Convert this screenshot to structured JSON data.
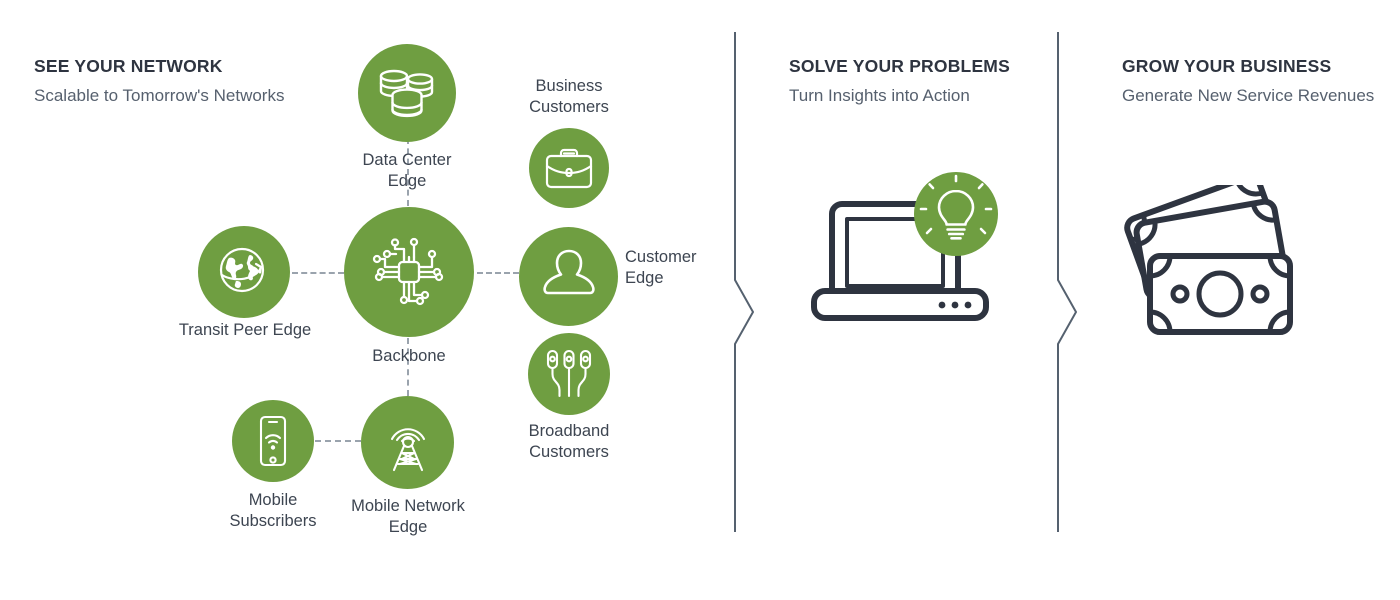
{
  "theme": {
    "green": "#6f9e41",
    "navy": "#2e3440",
    "text": "#3d4551",
    "subtext": "#56606e",
    "dash": "#9aa3ad",
    "background": "#ffffff"
  },
  "sections": [
    {
      "id": "see-your-network",
      "title": "SEE YOUR NETWORK",
      "subtitle": "Scalable to Tomorrow's Networks"
    },
    {
      "id": "solve-your-problems",
      "title": "SOLVE YOUR PROBLEMS",
      "subtitle": "Turn Insights into Action"
    },
    {
      "id": "grow-your-business",
      "title": "GROW YOUR BUSINESS",
      "subtitle": "Generate New Service Revenues"
    }
  ],
  "network": {
    "nodes": [
      {
        "id": "data-center-edge",
        "label": "Data Center\nEdge",
        "icon": "database-stack-icon"
      },
      {
        "id": "backbone",
        "label": "Backbone",
        "icon": "circuit-chip-icon"
      },
      {
        "id": "transit-peer-edge",
        "label": "Transit Peer Edge",
        "icon": "globe-icon"
      },
      {
        "id": "mobile-subscribers",
        "label": "Mobile\nSubscribers",
        "icon": "smartphone-wifi-icon"
      },
      {
        "id": "mobile-network-edge",
        "label": "Mobile Network\nEdge",
        "icon": "cell-tower-icon"
      },
      {
        "id": "business-customers",
        "label": "Business\nCustomers",
        "icon": "briefcase-icon"
      },
      {
        "id": "customer-edge",
        "label": "Customer\nEdge",
        "icon": "person-icon"
      },
      {
        "id": "broadband-customers",
        "label": "Broadband\nCustomers",
        "icon": "fiber-connectors-icon"
      }
    ]
  },
  "illustrations": {
    "insight": {
      "id": "laptop-lightbulb",
      "laptop_icon": "laptop-icon",
      "badge_icon": "lightbulb-icon"
    },
    "revenue": {
      "id": "banknotes",
      "icon": "money-banknotes-icon"
    }
  },
  "dividers": [
    {
      "id": "divider-1",
      "icon": "chevron-right-divider-icon"
    },
    {
      "id": "divider-2",
      "icon": "chevron-right-divider-icon"
    }
  ]
}
